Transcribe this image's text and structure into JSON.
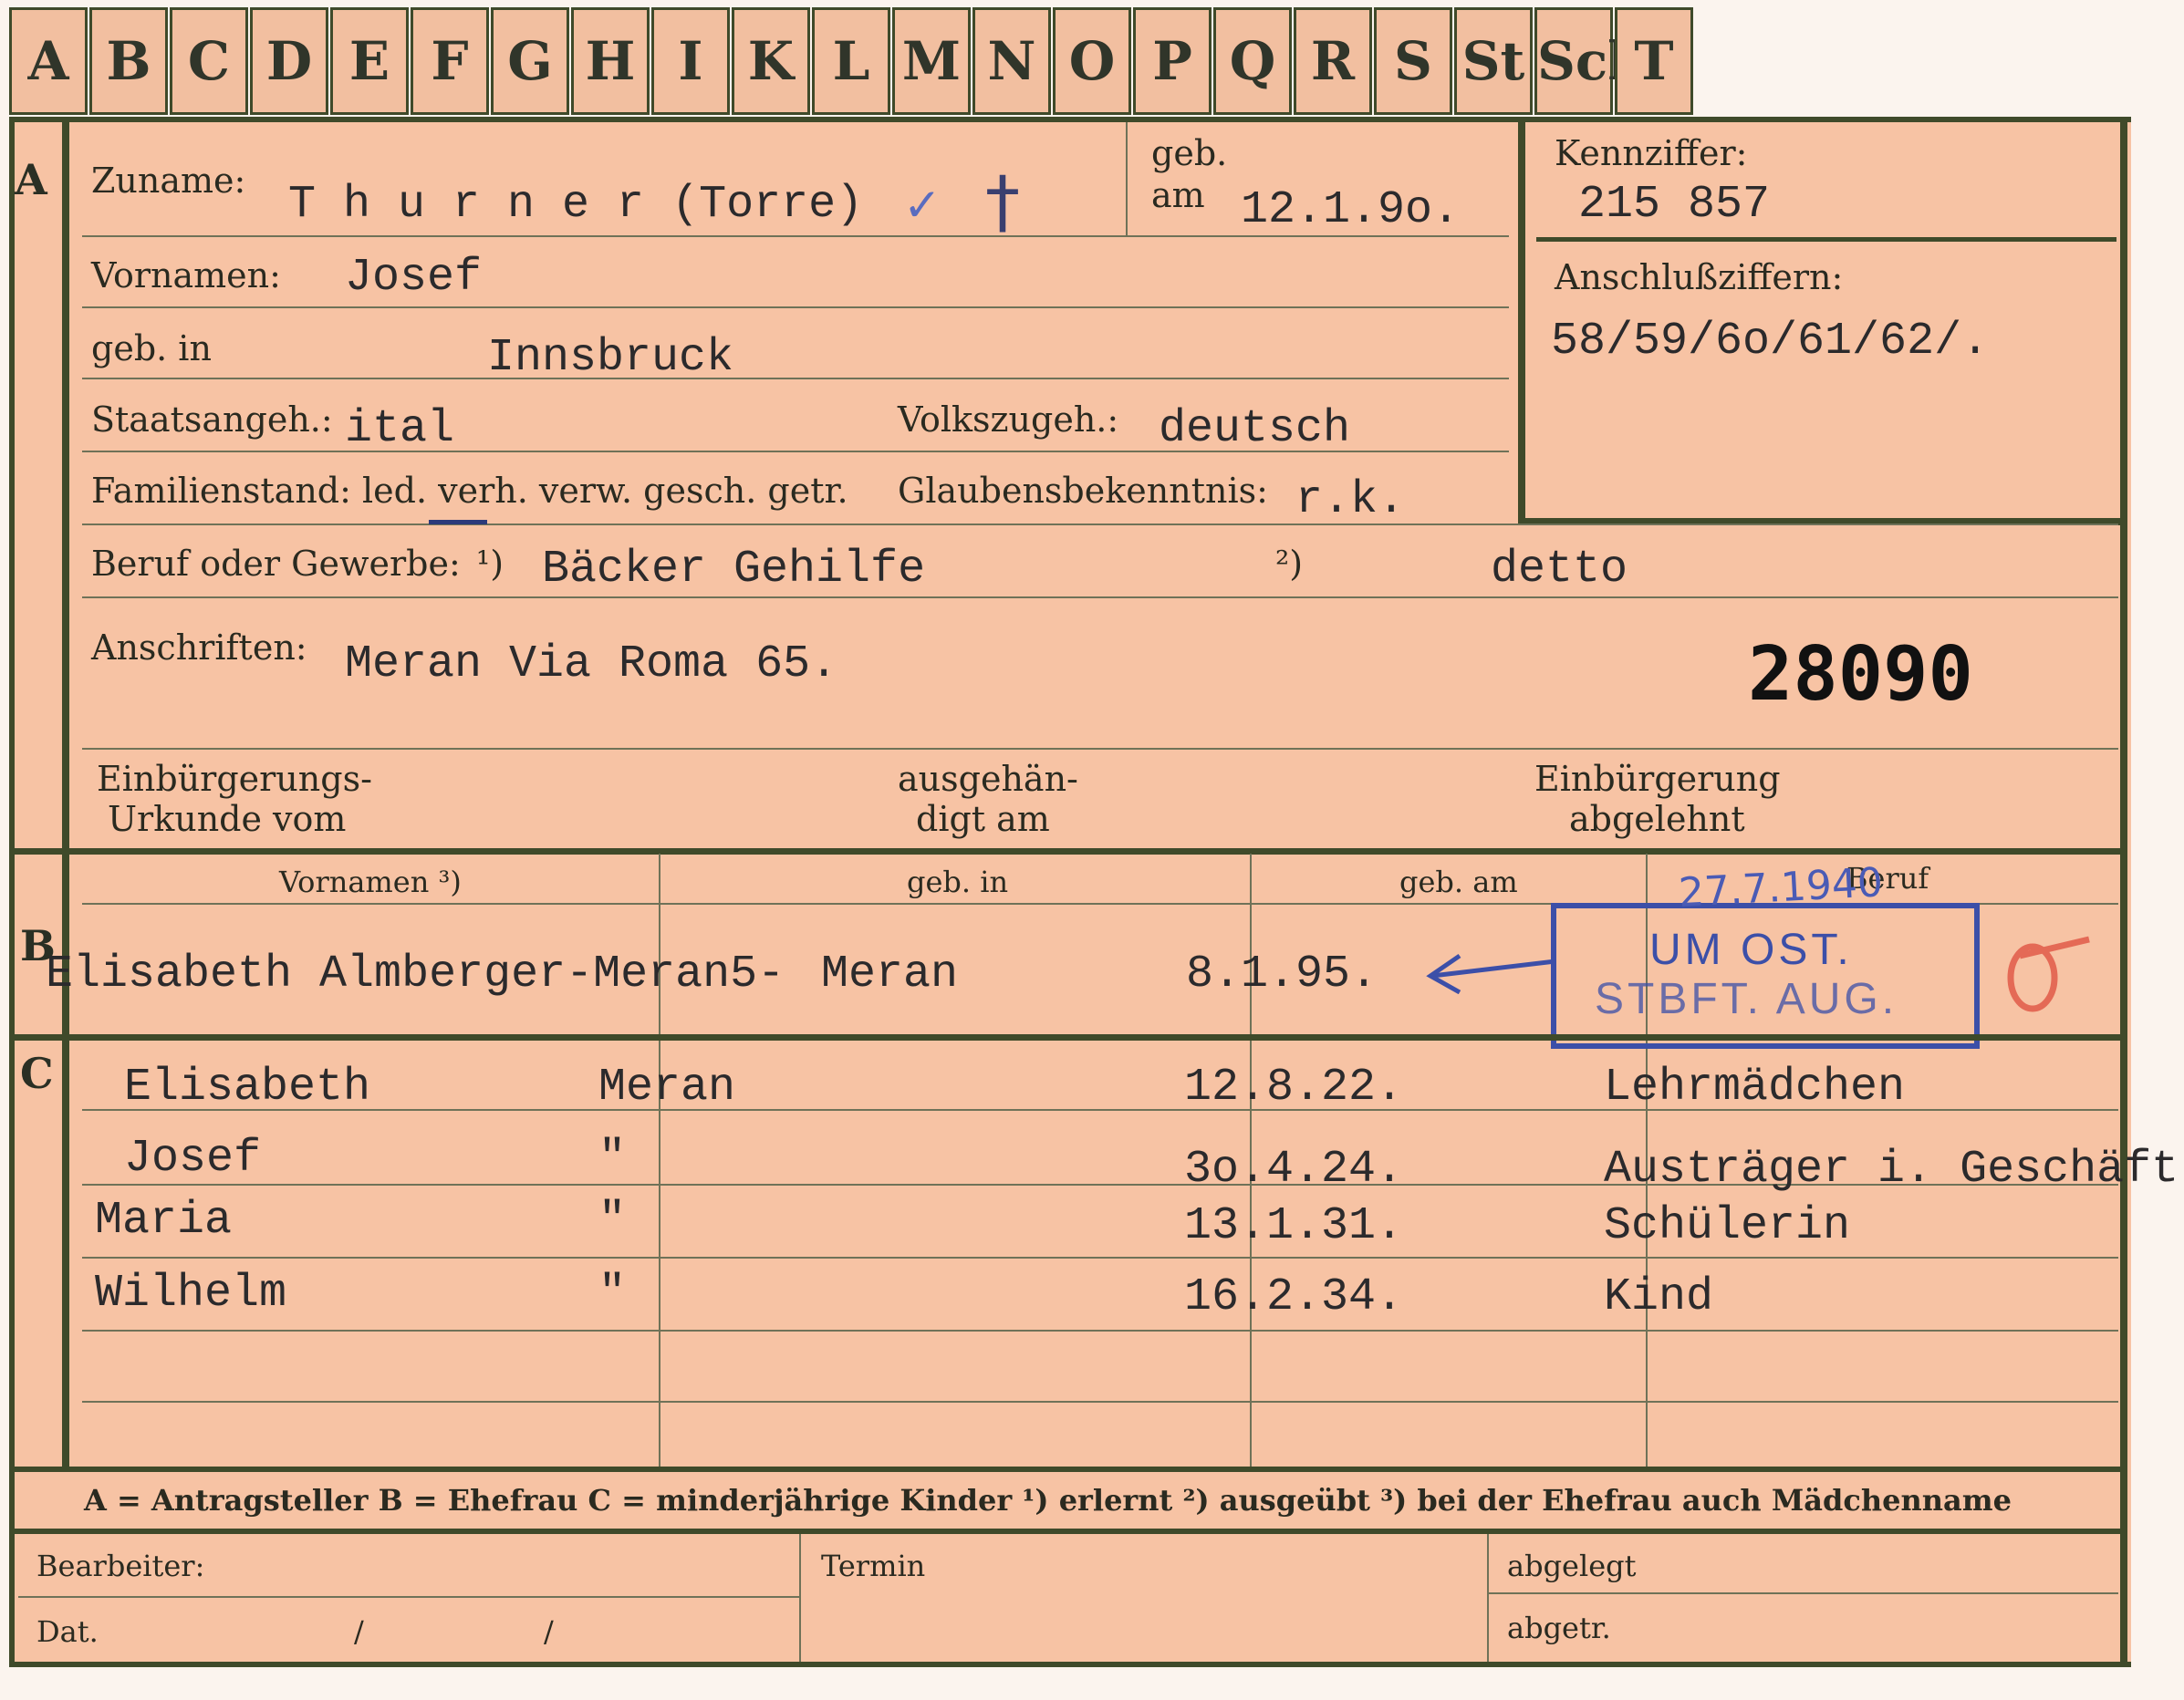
{
  "tabs": [
    "A",
    "B",
    "C",
    "D",
    "E",
    "F",
    "G",
    "H",
    "I",
    "K",
    "L",
    "M",
    "N",
    "O",
    "P",
    "Q",
    "R",
    "S",
    "St",
    "Sch",
    "T"
  ],
  "sections": {
    "a": "A",
    "b": "B",
    "c": "C"
  },
  "applicant": {
    "surname_label": "Zuname:",
    "surname": "T h u r n e r (Torre)",
    "check_mark": "✓",
    "cross": "†",
    "born_label_1": "geb.",
    "born_label_2": "am",
    "born_date": "12.1.9o.",
    "id_label": "Kennziffer:",
    "id": "215 857",
    "connect_label": "Anschlußziffern:",
    "connect": "58/59/6o/61/62/.",
    "firstname_label": "Vornamen:",
    "firstname": "Josef",
    "birthplace_label": "geb. in",
    "birthplace": "Innsbruck",
    "citizenship_label": "Staatsangeh.:",
    "citizenship": "ital",
    "ethnicity_label": "Volkszugeh.:",
    "ethnicity": "deutsch",
    "marital_label": "Familienstand: led. verh. verw. gesch. getr.",
    "religion_label": "Glaubensbekenntnis:",
    "religion": "r.k.",
    "occupation_label": "Beruf oder Gewerbe:",
    "fn1": "¹)",
    "occupation_1": "Bäcker Gehilfe",
    "fn2": "²)",
    "occupation_2": "detto",
    "address_label": "Anschriften:",
    "address": "Meran Via Roma 65.",
    "file_number": "28090",
    "naturalization_label_1": "Einbürgerungs-",
    "naturalization_label_2": "Urkunde vom",
    "handed_label_1": "ausgehän-",
    "handed_label_2": "digt am",
    "rejected_label_1": "Einbürgerung",
    "rejected_label_2": "abgelehnt"
  },
  "wife_header": {
    "firstname": "Vornamen ³)",
    "birthplace": "geb. in",
    "birthdate": "geb. am",
    "occupation": "Beruf"
  },
  "wife": {
    "name": "Elisabeth Almberger-Meran5-",
    "birthplace": "Meran",
    "birthdate": "8.1.95."
  },
  "stamp": {
    "line1": "UM OST.",
    "line2": "STBFT. AUG.",
    "handwritten": "27.7.1940"
  },
  "children": [
    {
      "name": "Elisabeth",
      "place": "Meran",
      "date": "12.8.22.",
      "occupation": "Lehrmädchen"
    },
    {
      "name": "Josef",
      "place": "\"",
      "date": "3o.4.24.",
      "occupation": "Austräger i. Geschäft"
    },
    {
      "name": "Maria",
      "place": "\"",
      "date": "13.1.31.",
      "occupation": "Schülerin"
    },
    {
      "name": "Wilhelm",
      "place": "\"",
      "date": "16.2.34.",
      "occupation": "Kind"
    }
  ],
  "legend": "A = Antragsteller   B = Ehefrau   C = minderjährige Kinder   ¹) erlernt   ²) ausgeübt   ³) bei der Ehefrau auch Mädchenname",
  "footer": {
    "clerk": "Bearbeiter:",
    "term": "Termin",
    "filed": "abgelegt",
    "date": "Dat.",
    "slash1": "/",
    "slash2": "/",
    "deregistered": "abgetr."
  },
  "colors": {
    "card": "#f7c3a4",
    "lines": "#3f4a2a",
    "stamp": "#3c4fa8",
    "red": "#e46a56"
  }
}
